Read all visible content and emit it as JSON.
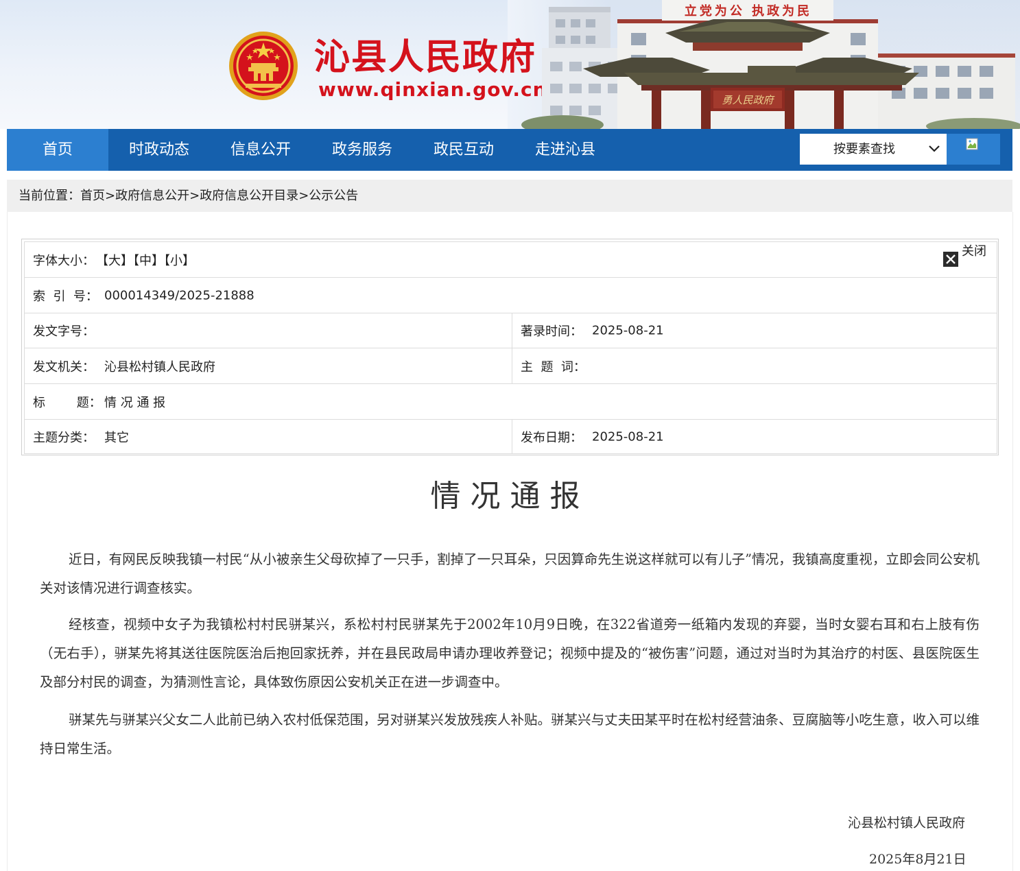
{
  "banner": {
    "site_name": "沁县人民政府",
    "site_url": "www.qinxian.gov.cn",
    "slogan": "立党为公 执政为民",
    "gate_inscription": "勇人民政府",
    "brand_color": "#d4121c"
  },
  "nav": {
    "items": [
      {
        "label": "首页",
        "active": true
      },
      {
        "label": "时政动态"
      },
      {
        "label": "信息公开"
      },
      {
        "label": "政务服务"
      },
      {
        "label": "政民互动"
      },
      {
        "label": "走进沁县"
      }
    ],
    "search_select": "按要素查找",
    "search_icon": "broken-image-icon",
    "nav_color": "#1560ad",
    "active_color": "#2c7fd0"
  },
  "breadcrumb": {
    "prefix": "当前位置：",
    "items": [
      "首页",
      "政府信息公开",
      "政府信息公开目录",
      "公示公告"
    ],
    "separator": ">"
  },
  "meta": {
    "font_size_label": "字体大小：",
    "font_sizes": [
      "【大】",
      "【中】",
      "【小】"
    ],
    "close_label": "关闭",
    "close_icon": "close-icon",
    "index_label": "索  引  号：",
    "index_value": "000014349/2025-21888",
    "doc_no_label": "发文字号：",
    "doc_no_value": "",
    "record_time_label": "著录时间：",
    "record_time_value": "2025-08-21",
    "issuer_label": "发文机关：",
    "issuer_value": "沁县松村镇人民政府",
    "keywords_label": "主  题  词：",
    "keywords_value": "",
    "title_label": "标        题：",
    "title_value": "情 况 通 报",
    "category_label": "主题分类：",
    "category_value": "其它",
    "publish_label": "发布日期：",
    "publish_value": "2025-08-21"
  },
  "article": {
    "title": "情况通报",
    "paragraphs": [
      "近日，有网民反映我镇一村民“从小被亲生父母砍掉了一只手，割掉了一只耳朵，只因算命先生说这样就可以有儿子”情况，我镇高度重视，立即会同公安机关对该情况进行调查核实。",
      "经核查，视频中女子为我镇松村村民骈某兴，系松村村民骈某先于2002年10月9日晚，在322省道旁一纸箱内发现的弃婴，当时女婴右耳和右上肢有伤（无右手），骈某先将其送往医院医治后抱回家抚养，并在县民政局申请办理收养登记；视频中提及的“被伤害”问题，通过对当时为其治疗的村医、县医院医生及部分村民的调查，为猜测性言论，具体致伤原因公安机关正在进一步调查中。",
      "骈某先与骈某兴父女二人此前已纳入农村低保范围，另对骈某兴发放残疾人补贴。骈某兴与丈夫田某平时在松村经营油条、豆腐脑等小吃生意，收入可以维持日常生活。"
    ],
    "signature": "沁县松村镇人民政府",
    "date": "2025年8月21日"
  }
}
